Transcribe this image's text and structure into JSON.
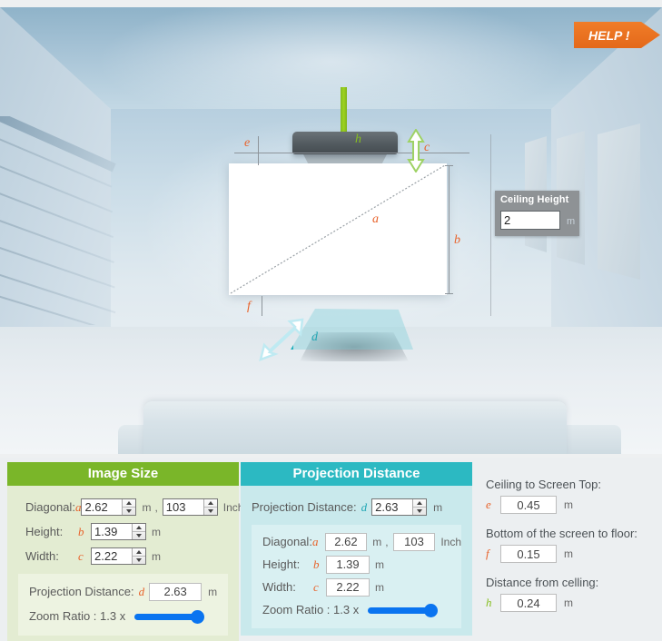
{
  "help": {
    "label": "HELP !"
  },
  "scene": {
    "ceiling_height": {
      "title": "Ceiling Height",
      "value": "2",
      "unit": "m"
    },
    "labels": {
      "a": "a",
      "b": "b",
      "c": "c",
      "d": "d",
      "e": "e",
      "f": "f",
      "h": "h"
    }
  },
  "image_size": {
    "title": "Image Size",
    "diagonal_label": "Diagonal:",
    "diagonal_sym": "a",
    "diagonal_m": "2.62",
    "unit_m": "m",
    "comma": ",",
    "diagonal_inch": "103",
    "unit_inch": "Inch",
    "height_label": "Height:",
    "height_sym": "b",
    "height_m": "1.39",
    "width_label": "Width:",
    "width_sym": "c",
    "width_m": "2.22",
    "proj_label": "Projection Distance:",
    "proj_sym": "d",
    "proj_value": "2.63",
    "zoom_label": "Zoom Ratio : 1.3 x"
  },
  "projection_distance": {
    "title": "Projection Distance",
    "proj_label": "Projection Distance:",
    "proj_sym": "d",
    "proj_value": "2.63",
    "unit_m": "m",
    "diagonal_label": "Diagonal:",
    "diagonal_sym": "a",
    "diagonal_m": "2.62",
    "comma": ",",
    "diagonal_inch": "103",
    "unit_inch": "Inch",
    "height_label": "Height:",
    "height_sym": "b",
    "height_m": "1.39",
    "width_label": "Width:",
    "width_sym": "c",
    "width_m": "2.22",
    "zoom_label": "Zoom Ratio : 1.3 x"
  },
  "side_info": {
    "ceiling_to_screen_top": {
      "title": "Ceiling to Screen Top:",
      "sym": "e",
      "value": "0.45",
      "unit": "m"
    },
    "bottom_to_floor": {
      "title": "Bottom of the screen to floor:",
      "sym": "f",
      "value": "0.15",
      "unit": "m"
    },
    "distance_from_ceiling": {
      "title": "Distance from celling:",
      "sym": "h",
      "value": "0.24",
      "unit": "m"
    }
  },
  "colors": {
    "image_size_header": "#7ab629",
    "projection_header": "#2cb9c2",
    "help_orange": "#e4691a",
    "slider_blue": "#0a74f0",
    "label_orange": "#e8622a",
    "label_green": "#86bf20",
    "label_teal": "#23a8b5"
  }
}
